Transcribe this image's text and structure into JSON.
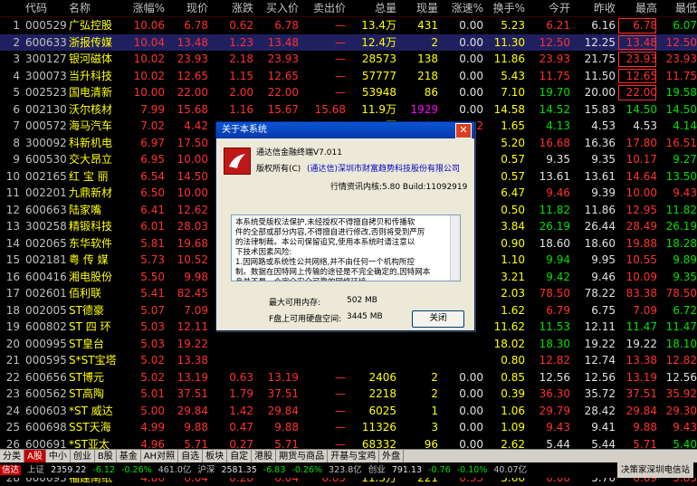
{
  "headers": {
    "code": "代码",
    "name": "名称",
    "pct": "涨幅%",
    "price": "现价",
    "chg": "涨跌",
    "bid": "买入价",
    "ask": "卖出价",
    "vol": "总量",
    "cur": "现量",
    "spd": "涨速%",
    "tov": "换手%",
    "open": "今开",
    "prev": "昨收",
    "high": "最高",
    "low": "最低"
  },
  "rows": [
    {
      "idx": "1",
      "code": "000529",
      "name": "广弘控股",
      "pct": "10.06",
      "price": "6.78",
      "chg": "0.62",
      "bid": "6.78",
      "ask": "—",
      "vol": "13.4万",
      "cur": "431",
      "spd": "0.00",
      "tov": "5.23",
      "open": "6.21",
      "prev": "6.16",
      "high": "6.78",
      "low": "6.07"
    },
    {
      "idx": "2",
      "code": "600633",
      "name": "浙报传媒",
      "pct": "10.04",
      "price": "13.48",
      "chg": "1.23",
      "bid": "13.48",
      "ask": "—",
      "vol": "12.4万",
      "cur": "2",
      "spd": "0.00",
      "tov": "11.30",
      "open": "12.50",
      "prev": "12.25",
      "high": "13.48",
      "low": "12.50"
    },
    {
      "idx": "3",
      "code": "300127",
      "name": "银河磁体",
      "pct": "10.02",
      "price": "23.93",
      "chg": "2.18",
      "bid": "23.93",
      "ask": "—",
      "vol": "28573",
      "cur": "138",
      "spd": "0.00",
      "tov": "11.86",
      "open": "23.93",
      "prev": "21.75",
      "high": "23.93",
      "low": "23.93"
    },
    {
      "idx": "4",
      "code": "300073",
      "name": "当升科技",
      "pct": "10.02",
      "price": "12.65",
      "chg": "1.15",
      "bid": "12.65",
      "ask": "—",
      "vol": "57777",
      "cur": "218",
      "spd": "0.00",
      "tov": "5.43",
      "open": "11.75",
      "prev": "11.50",
      "high": "12.65",
      "low": "11.75"
    },
    {
      "idx": "5",
      "code": "002523",
      "name": "国电清新",
      "pct": "10.00",
      "price": "22.00",
      "chg": "2.00",
      "bid": "22.00",
      "ask": "—",
      "vol": "53948",
      "cur": "86",
      "spd": "0.00",
      "tov": "7.10",
      "open": "19.70",
      "prev": "20.00",
      "high": "22.00",
      "low": "19.58"
    },
    {
      "idx": "6",
      "code": "002130",
      "name": "沃尔核材",
      "pct": "7.99",
      "price": "15.68",
      "chg": "1.16",
      "bid": "15.67",
      "ask": "15.68",
      "vol": "11.9万",
      "cur": "1929",
      "spd": "0.00",
      "tov": "14.58",
      "open": "14.52",
      "prev": "15.83",
      "high": "14.50",
      "low": "14.50"
    },
    {
      "idx": "7",
      "code": "000572",
      "name": "海马汽车",
      "pct": "7.02",
      "price": "4.42",
      "chg": "0.29",
      "bid": "4.42",
      "ask": "4.43",
      "vol": "17.3万",
      "cur": "3704",
      "spd": "0.22",
      "tov": "1.65",
      "open": "4.13",
      "prev": "4.53",
      "high": "4.53",
      "low": "4.14"
    },
    {
      "idx": "8",
      "code": "300092",
      "name": "科新机电",
      "pct": "6.97",
      "price": "17.50",
      "chg": "",
      "bid": "",
      "ask": "",
      "vol": "",
      "cur": "",
      "spd": "",
      "tov": "5.20",
      "open": "16.68",
      "prev": "16.36",
      "high": "17.80",
      "low": "16.51"
    },
    {
      "idx": "9",
      "code": "600530",
      "name": "交大昂立",
      "pct": "6.95",
      "price": "10.00",
      "chg": "",
      "bid": "",
      "ask": "",
      "vol": "",
      "cur": "",
      "spd": "",
      "tov": "0.57",
      "open": "9.35",
      "prev": "9.35",
      "high": "10.17",
      "low": "9.27"
    },
    {
      "idx": "10",
      "code": "002165",
      "name": "红 宝 丽",
      "pct": "6.54",
      "price": "14.50",
      "chg": "",
      "bid": "",
      "ask": "",
      "vol": "",
      "cur": "",
      "spd": "",
      "tov": "0.57",
      "open": "13.61",
      "prev": "13.61",
      "high": "14.64",
      "low": "13.50"
    },
    {
      "idx": "11",
      "code": "002201",
      "name": "九鼎新材",
      "pct": "6.50",
      "price": "10.00",
      "chg": "",
      "bid": "",
      "ask": "",
      "vol": "",
      "cur": "",
      "spd": "",
      "tov": "6.47",
      "open": "9.46",
      "prev": "9.39",
      "high": "10.00",
      "low": "9.43"
    },
    {
      "idx": "12",
      "code": "600663",
      "name": "陆家嘴",
      "pct": "6.41",
      "price": "12.62",
      "chg": "",
      "bid": "",
      "ask": "",
      "vol": "",
      "cur": "",
      "spd": "",
      "tov": "0.50",
      "open": "11.82",
      "prev": "11.86",
      "high": "12.95",
      "low": "11.82"
    },
    {
      "idx": "13",
      "code": "300258",
      "name": "精锻科技",
      "pct": "6.01",
      "price": "28.03",
      "chg": "",
      "bid": "",
      "ask": "",
      "vol": "",
      "cur": "",
      "spd": "",
      "tov": "3.84",
      "open": "26.19",
      "prev": "26.44",
      "high": "28.49",
      "low": "26.19"
    },
    {
      "idx": "14",
      "code": "002065",
      "name": "东华软件",
      "pct": "5.81",
      "price": "19.68",
      "chg": "",
      "bid": "",
      "ask": "",
      "vol": "",
      "cur": "",
      "spd": "",
      "tov": "0.90",
      "open": "18.60",
      "prev": "18.60",
      "high": "19.88",
      "low": "18.28"
    },
    {
      "idx": "15",
      "code": "002181",
      "name": "粤 传 媒",
      "pct": "5.73",
      "price": "10.52",
      "chg": "",
      "bid": "",
      "ask": "",
      "vol": "",
      "cur": "",
      "spd": "",
      "tov": "1.10",
      "open": "9.94",
      "prev": "9.95",
      "high": "10.55",
      "low": "9.89"
    },
    {
      "idx": "16",
      "code": "600416",
      "name": "湘电股份",
      "pct": "5.50",
      "price": "9.98",
      "chg": "",
      "bid": "",
      "ask": "",
      "vol": "",
      "cur": "",
      "spd": "",
      "tov": "3.21",
      "open": "9.42",
      "prev": "9.46",
      "high": "10.09",
      "low": "9.35"
    },
    {
      "idx": "17",
      "code": "002601",
      "name": "佰利联",
      "pct": "5.41",
      "price": "82.45",
      "chg": "",
      "bid": "",
      "ask": "",
      "vol": "",
      "cur": "",
      "spd": "",
      "tov": "2.03",
      "open": "78.50",
      "prev": "78.22",
      "high": "83.38",
      "low": "78.50"
    },
    {
      "idx": "18",
      "code": "002005",
      "name": "ST德豪",
      "pct": "5.07",
      "price": "7.09",
      "chg": "",
      "bid": "",
      "ask": "",
      "vol": "",
      "cur": "",
      "spd": "",
      "tov": "1.62",
      "open": "6.79",
      "prev": "6.75",
      "high": "7.09",
      "low": "6.72"
    },
    {
      "idx": "19",
      "code": "600802",
      "name": "ST 四 环",
      "pct": "5.03",
      "price": "12.11",
      "chg": "",
      "bid": "",
      "ask": "",
      "vol": "",
      "cur": "",
      "spd": "",
      "tov": "11.62",
      "open": "11.53",
      "prev": "12.11",
      "high": "11.47",
      "low": "11.47"
    },
    {
      "idx": "20",
      "code": "000995",
      "name": "ST皇台",
      "pct": "5.03",
      "price": "19.22",
      "chg": "",
      "bid": "",
      "ask": "",
      "vol": "",
      "cur": "",
      "spd": "",
      "tov": "18.02",
      "open": "18.30",
      "prev": "19.22",
      "high": "19.22",
      "low": "18.10"
    },
    {
      "idx": "21",
      "code": "000595",
      "name": "S*ST宝塔",
      "pct": "5.02",
      "price": "13.38",
      "chg": "",
      "bid": "",
      "ask": "",
      "vol": "",
      "cur": "",
      "spd": "",
      "tov": "0.80",
      "open": "12.82",
      "prev": "12.74",
      "high": "13.38",
      "low": "12.82"
    },
    {
      "idx": "22",
      "code": "600656",
      "name": "ST博元",
      "pct": "5.02",
      "price": "13.19",
      "chg": "0.63",
      "bid": "13.19",
      "ask": "—",
      "vol": "2406",
      "cur": "2",
      "spd": "0.00",
      "tov": "0.85",
      "open": "12.56",
      "prev": "12.56",
      "high": "13.19",
      "low": "12.56"
    },
    {
      "idx": "23",
      "code": "600562",
      "name": "ST高陶",
      "pct": "5.01",
      "price": "37.51",
      "chg": "1.79",
      "bid": "37.51",
      "ask": "—",
      "vol": "2218",
      "cur": "2",
      "spd": "0.00",
      "tov": "0.39",
      "open": "36.30",
      "prev": "35.72",
      "high": "37.51",
      "low": "35.92"
    },
    {
      "idx": "24",
      "code": "600603",
      "name": "*ST 威达",
      "pct": "5.00",
      "price": "29.84",
      "chg": "1.42",
      "bid": "29.84",
      "ask": "—",
      "vol": "6025",
      "cur": "1",
      "spd": "0.00",
      "tov": "1.06",
      "open": "29.79",
      "prev": "28.42",
      "high": "29.84",
      "low": "29.30"
    },
    {
      "idx": "25",
      "code": "600698",
      "name": "SST天海",
      "pct": "4.99",
      "price": "9.88",
      "chg": "0.47",
      "bid": "9.88",
      "ask": "—",
      "vol": "11326",
      "cur": "3",
      "spd": "0.00",
      "tov": "1.09",
      "open": "9.43",
      "prev": "9.41",
      "high": "9.88",
      "low": "9.43"
    },
    {
      "idx": "26",
      "code": "600691",
      "name": "*ST亚太",
      "pct": "4.96",
      "price": "5.71",
      "chg": "0.27",
      "bid": "5.71",
      "ask": "—",
      "vol": "68332",
      "cur": "96",
      "spd": "0.00",
      "tov": "2.62",
      "open": "5.44",
      "prev": "5.44",
      "high": "5.71",
      "low": "5.40"
    },
    {
      "idx": "27",
      "code": "000955",
      "name": "ST欣龙",
      "pct": "4.95",
      "price": "6.15",
      "chg": "0.29",
      "bid": "6.15",
      "ask": "—",
      "vol": "1234",
      "cur": "2",
      "spd": "0.00",
      "tov": "5.87",
      "open": "5.87",
      "prev": "5.86",
      "high": "6.15",
      "low": "5.80"
    },
    {
      "idx": "28",
      "code": "600693",
      "name": "福建南纸",
      "pct": "4.86",
      "price": "6.04",
      "chg": "0.28",
      "bid": "6.04",
      "ask": "6.05",
      "vol": "11.3万",
      "cur": "221",
      "spd": "0.33",
      "tov": "5.66",
      "open": "6.00",
      "prev": "5.76",
      "high": "6.09",
      "low": "5.85"
    }
  ],
  "tabs": [
    "分类",
    "A股",
    "中小",
    "创业",
    "B股",
    "基金",
    "AH对照",
    "自选",
    "板块",
    "自定",
    "港股",
    "期货与商品",
    "开基与宝鸡",
    "外盘"
  ],
  "status": {
    "sh_label": "上证",
    "sh_val": "2359.22",
    "sh_chg": "-6.12",
    "sh_pct": "-0.26%",
    "sh_amt": "461.0亿",
    "sz_label": "沪深",
    "sz_val": "2581.35",
    "sz_chg": "-6.83",
    "sz_pct": "-0.26%",
    "sz_amt": "323.8亿",
    "cy_label": "创业",
    "cy_val": "791.13",
    "cy_chg": "-0.76",
    "cy_pct": "-0.10%",
    "cy_amt": "40.07亿",
    "right": "决策家深圳电信站",
    "brand": "信达"
  },
  "dialog": {
    "title": "关于本系统",
    "close_glyph": "✕",
    "product": "通达信金融终端V7.011",
    "copyright_label": "版权所有(C)",
    "company": "(通达信)深圳市财富趋势科技股份有限公司",
    "kernel": "行情资讯内核:5.80 Build:11092919",
    "info_lines": [
      "本系统受版权法保护,未经授权不得擅自拷贝和传播软",
      "件的全部或部分内容,不得擅自进行修改,否则将受到严厉",
      "的法律制裁。本公司保留追究,使用本系统时请注意以",
      "下技术因素风险:",
      "  1.因网路或系统性公共网络,并不由任何一个机构所控",
      "制。数据在因特网上传输的途径是不完全确定的,因特网本",
      "身并不是一个完全安全可靠的网络环境。"
    ],
    "mem_label": "最大可用内存:",
    "mem_value": "502 MB",
    "disk_label": "F盘上可用硬盘空间:",
    "disk_value": "3445 MB",
    "close_button": "关闭"
  },
  "colors": {
    "up": "#ff3030",
    "down": "#00e000",
    "name": "#ffff00",
    "magenta": "#ff00ff"
  }
}
